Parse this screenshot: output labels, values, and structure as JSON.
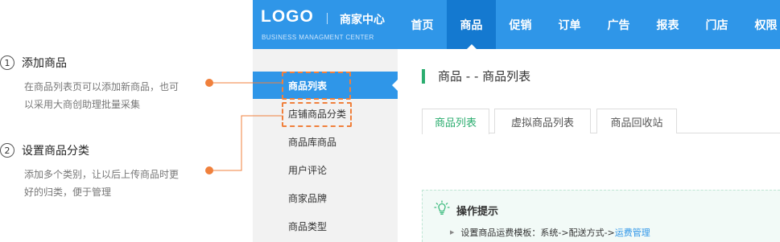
{
  "annotations": [
    {
      "number": "1",
      "title": "添加商品",
      "desc": "在商品列表页可以添加新商品，也可以采用大商创助理批量采集"
    },
    {
      "number": "2",
      "title": "设置商品分类",
      "desc": "添加多个类别，让以后上传商品时更好的归类，便于管理"
    }
  ],
  "header": {
    "logo": "LOGO",
    "center_name": "商家中心",
    "subtitle": "BUSINESS MANAGMENT CENTER",
    "nav": [
      "首页",
      "商品",
      "促销",
      "订单",
      "广告",
      "报表",
      "门店",
      "权限"
    ],
    "active_nav": "商品"
  },
  "sidebar": {
    "items": [
      "商品列表",
      "店铺商品分类",
      "商品库商品",
      "用户评论",
      "商家品牌",
      "商品类型"
    ],
    "active": "商品列表"
  },
  "main": {
    "title": "商品 - - 商品列表",
    "tabs": [
      "商品列表",
      "虚拟商品列表",
      "商品回收站"
    ],
    "active_tab": "商品列表",
    "tip": {
      "title": "操作提示",
      "item_text": "设置商品运费模板：系统->配送方式->",
      "item_link": "运费管理"
    }
  },
  "colors": {
    "brand_blue": "#2f96e8",
    "nav_active": "#1479d0",
    "accent_green": "#2bad6f",
    "annotation_orange": "#f0803c"
  },
  "icons": {
    "tip": "lightbulb-icon"
  }
}
